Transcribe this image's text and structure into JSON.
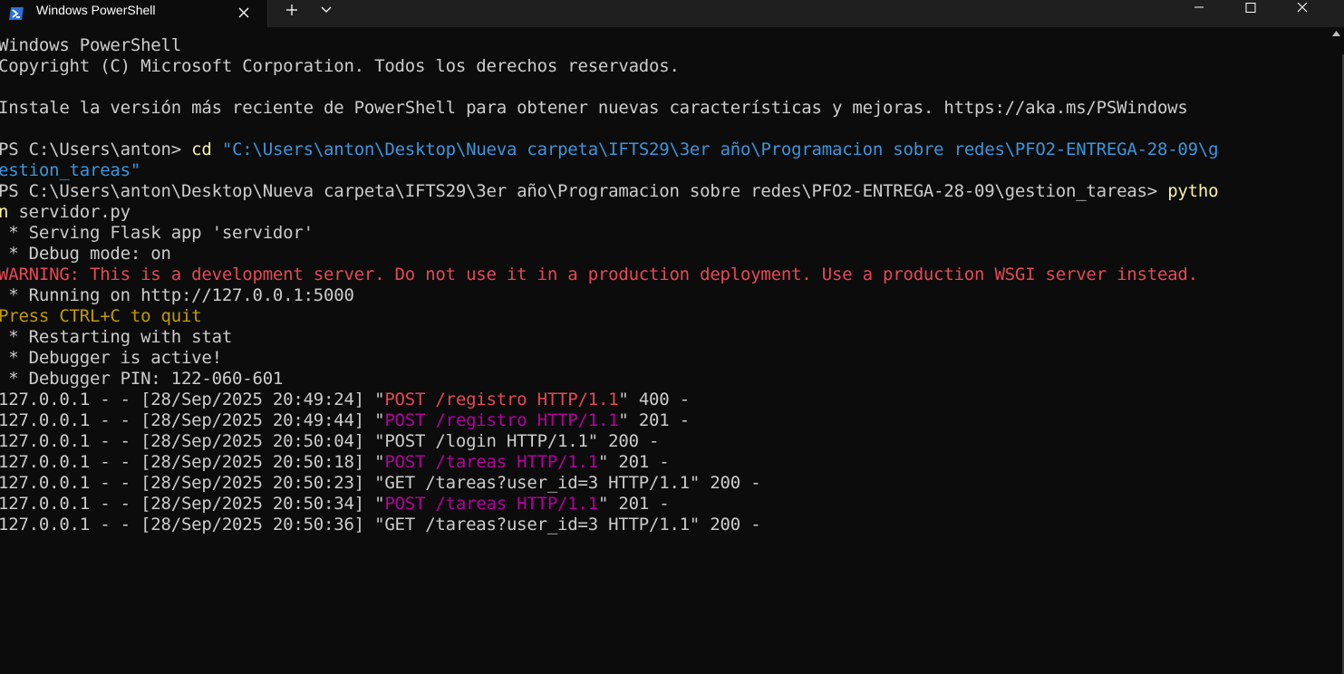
{
  "window": {
    "tab_title": "Windows PowerShell",
    "icons": {
      "tab": "powershell-icon",
      "close_tab": "close-icon",
      "new_tab": "plus-icon",
      "dropdown": "chevron-down-icon",
      "minimize": "minimize-icon",
      "maximize": "maximize-icon",
      "close": "close-icon"
    }
  },
  "colors": {
    "background": "#0c0c0c",
    "titlebar": "#1f1f1f",
    "text": "#cccccc",
    "command": "#f9f1a5",
    "string": "#3a96dd",
    "warning": "#e74856",
    "yellow": "#c19c00",
    "magenta": "#b4009e"
  },
  "terminal": {
    "lines": [
      [
        {
          "t": "Windows PowerShell",
          "c": "default"
        }
      ],
      [
        {
          "t": "Copyright (C) Microsoft Corporation. Todos los derechos reservados.",
          "c": "default"
        }
      ],
      [
        {
          "t": "",
          "c": "default"
        }
      ],
      [
        {
          "t": "Instale la versión más reciente de PowerShell para obtener nuevas características y mejoras. https://aka.ms/PSWindows",
          "c": "default"
        }
      ],
      [
        {
          "t": "",
          "c": "default"
        }
      ],
      [
        {
          "t": "PS C:\\Users\\anton> ",
          "c": "default"
        },
        {
          "t": "cd ",
          "c": "cmd"
        },
        {
          "t": "\"C:\\Users\\anton\\Desktop\\Nueva carpeta\\IFTS29\\3er año\\Programacion sobre redes\\PFO2-ENTREGA-28-09\\g",
          "c": "string"
        }
      ],
      [
        {
          "t": "estion_tareas\"",
          "c": "string"
        }
      ],
      [
        {
          "t": "PS C:\\Users\\anton\\Desktop\\Nueva carpeta\\IFTS29\\3er año\\Programacion sobre redes\\PFO2-ENTREGA-28-09\\gestion_tareas> ",
          "c": "default"
        },
        {
          "t": "pytho",
          "c": "cmd"
        }
      ],
      [
        {
          "t": "n",
          "c": "cmd"
        },
        {
          "t": " servidor.py",
          "c": "default"
        }
      ],
      [
        {
          "t": " * Serving Flask app 'servidor'",
          "c": "default"
        }
      ],
      [
        {
          "t": " * Debug mode: on",
          "c": "default"
        }
      ],
      [
        {
          "t": "WARNING: This is a development server. Do not use it in a production deployment. Use a production WSGI server instead.",
          "c": "warning"
        }
      ],
      [
        {
          "t": " * Running on http://127.0.0.1:5000",
          "c": "default"
        }
      ],
      [
        {
          "t": "Press CTRL+C to quit",
          "c": "yellow"
        }
      ],
      [
        {
          "t": " * Restarting with stat",
          "c": "default"
        }
      ],
      [
        {
          "t": " * Debugger is active!",
          "c": "default"
        }
      ],
      [
        {
          "t": " * Debugger PIN: 122-060-601",
          "c": "default"
        }
      ],
      [
        {
          "t": "127.0.0.1 - - [28/Sep/2025 20:49:24] \"",
          "c": "default"
        },
        {
          "t": "POST /registro HTTP/1.1",
          "c": "red"
        },
        {
          "t": "\" 400 -",
          "c": "default"
        }
      ],
      [
        {
          "t": "127.0.0.1 - - [28/Sep/2025 20:49:44] \"",
          "c": "default"
        },
        {
          "t": "POST /registro HTTP/1.1",
          "c": "magenta"
        },
        {
          "t": "\" 201 -",
          "c": "default"
        }
      ],
      [
        {
          "t": "127.0.0.1 - - [28/Sep/2025 20:50:04] \"POST /login HTTP/1.1\" 200 -",
          "c": "default"
        }
      ],
      [
        {
          "t": "127.0.0.1 - - [28/Sep/2025 20:50:18] \"",
          "c": "default"
        },
        {
          "t": "POST /tareas HTTP/1.1",
          "c": "magenta"
        },
        {
          "t": "\" 201 -",
          "c": "default"
        }
      ],
      [
        {
          "t": "127.0.0.1 - - [28/Sep/2025 20:50:23] \"GET /tareas?user_id=3 HTTP/1.1\" 200 -",
          "c": "default"
        }
      ],
      [
        {
          "t": "127.0.0.1 - - [28/Sep/2025 20:50:34] \"",
          "c": "default"
        },
        {
          "t": "POST /tareas HTTP/1.1",
          "c": "magenta"
        },
        {
          "t": "\" 201 -",
          "c": "default"
        }
      ],
      [
        {
          "t": "127.0.0.1 - - [28/Sep/2025 20:50:36] \"GET /tareas?user_id=3 HTTP/1.1\" 200 -",
          "c": "default"
        }
      ]
    ]
  }
}
